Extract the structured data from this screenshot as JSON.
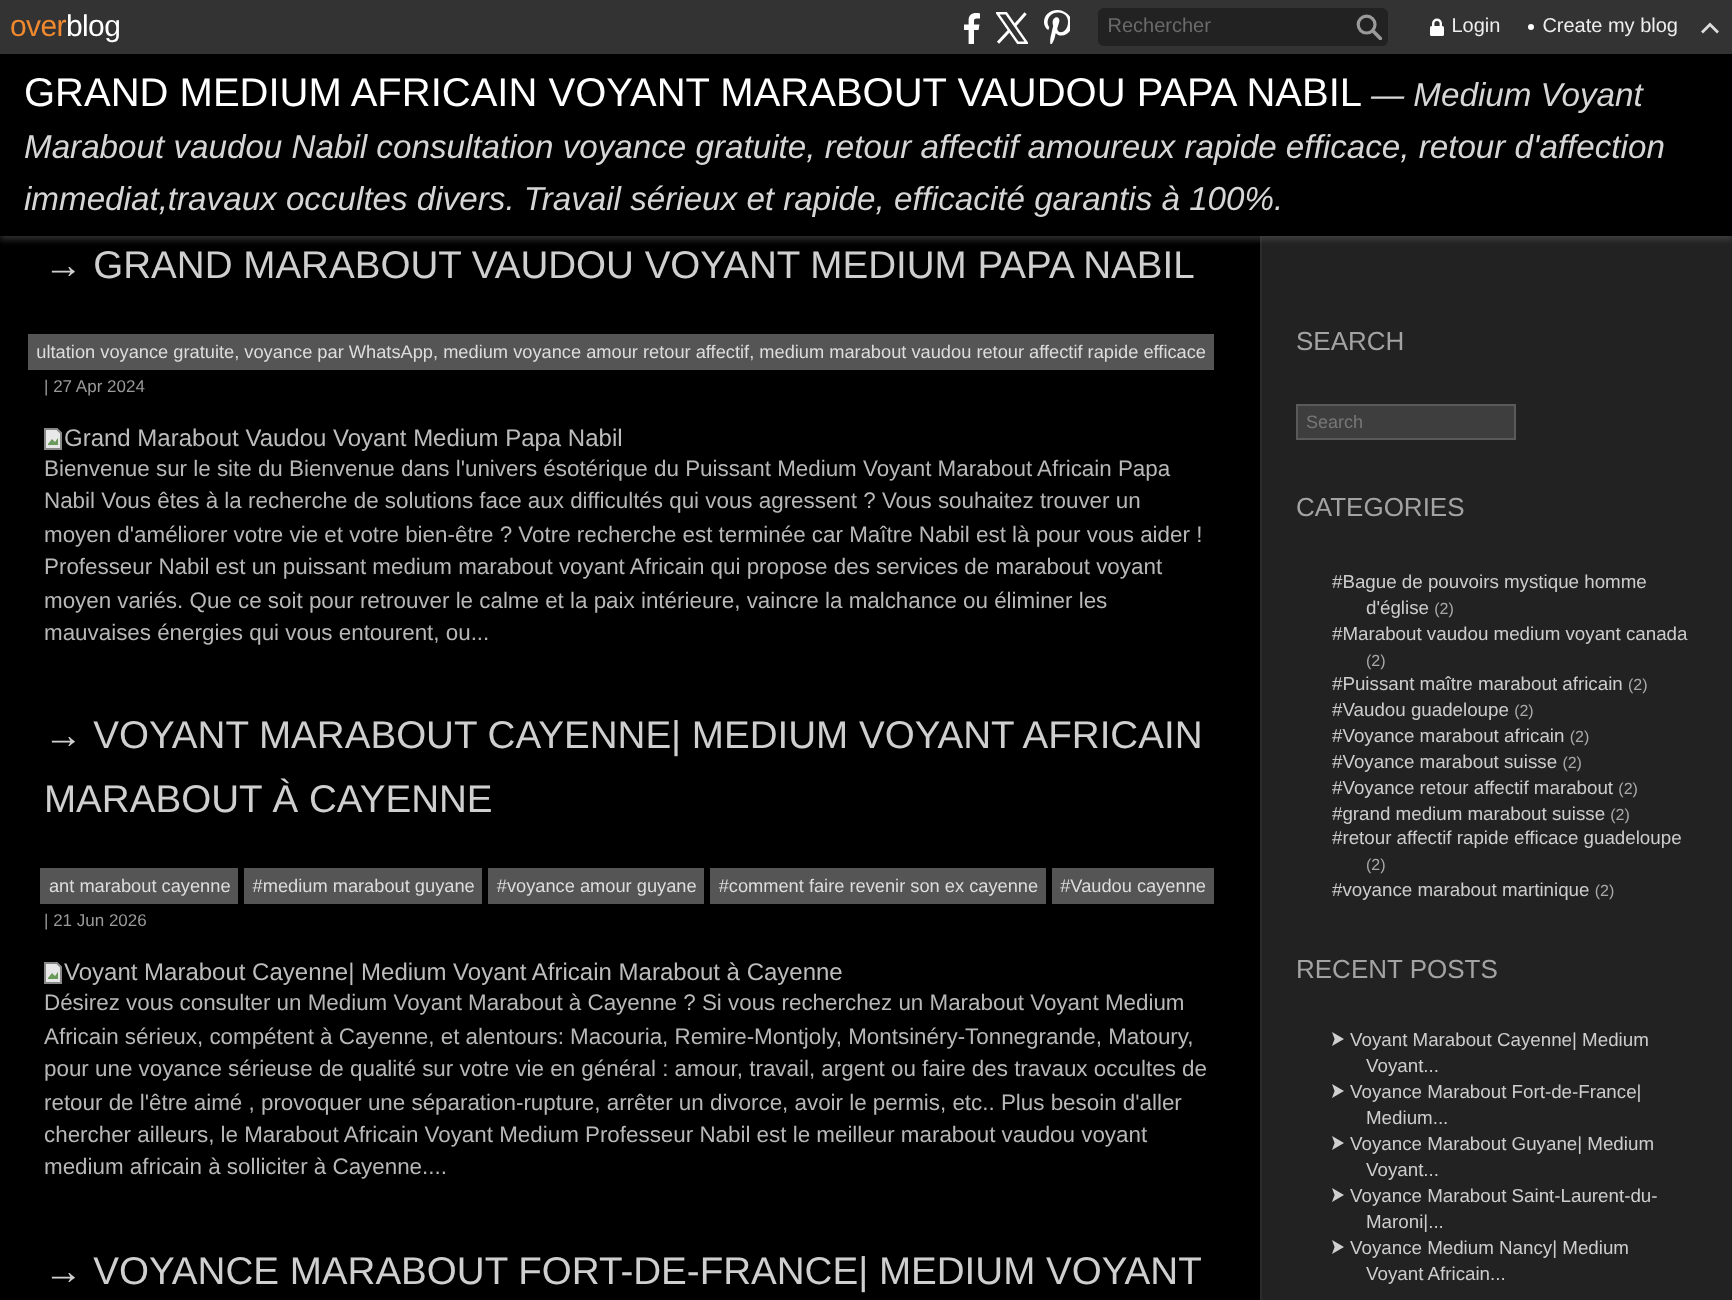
{
  "top_bar": {
    "logo": {
      "accent": "over",
      "rest": "blog"
    },
    "search": {
      "placeholder": "Rechercher"
    },
    "login": "Login",
    "create_blog": "Create my blog"
  },
  "header": {
    "title": "GRAND MEDIUM AFRICAIN VOYANT MARABOUT VAUDOU PAPA NABIL",
    "description": "— Medium Voyant Marabout vaudou Nabil consultation voyance gratuite, retour affectif amoureux rapide efficace, retour d'affection immediat,travaux occultes divers. Travail sérieux et rapide, efficacité garantis à 100%."
  },
  "posts": [
    {
      "title": "→ GRAND MARABOUT VAUDOU VOYANT MEDIUM PAPA NABIL",
      "tags": [
        "ultation voyance gratuite, voyance par WhatsApp, medium voyance amour retour affectif, medium marabout vaudou retour affectif rapide efficace"
      ],
      "date": "| 27 Apr 2024",
      "image_alt": "Grand Marabout Vaudou Voyant Medium Papa Nabil",
      "excerpt": "Bienvenue sur le site du Bienvenue dans l'univers ésotérique du Puissant Medium Voyant Marabout Africain Papa Nabil Vous êtes à la recherche de solutions face aux difficultés qui vous agressent ? Vous souhaitez trouver un moyen d'améliorer votre vie et votre bien-être ? Votre recherche est terminée car Maître Nabil est là pour vous aider ! Professeur Nabil est un puissant medium marabout voyant Africain qui propose des services de marabout voyant moyen variés. Que ce soit pour retrouver le calme et la paix intérieure, vaincre la malchance ou éliminer les mauvaises énergies qui vous entourent, ou..."
    },
    {
      "title": "→ VOYANT MARABOUT CAYENNE| MEDIUM VOYANT AFRICAIN MARABOUT À CAYENNE",
      "tags": [
        "ant marabout cayenne",
        "#medium marabout guyane",
        "#voyance amour guyane",
        "#comment faire revenir son ex cayenne",
        "#Vaudou cayenne"
      ],
      "date": "| 21 Jun 2026",
      "image_alt": "Voyant Marabout Cayenne| Medium Voyant Africain Marabout à Cayenne",
      "excerpt": "Désirez vous consulter un Medium Voyant Marabout à Cayenne ? Si vous recherchez un Marabout Voyant Medium Africain sérieux, compétent à Cayenne, et alentours: Macouria, Remire-Montjoly, Montsinéry-Tonnegrande, Matoury, pour une voyance sérieuse de qualité sur votre vie en général : amour, travail, argent ou faire des travaux occultes de retour de l'être aimé , provoquer une séparation-rupture, arrêter un divorce, avoir le permis, etc.. Plus besoin d'aller chercher ailleurs, le Marabout Africain Voyant Medium Professeur Nabil est le meilleur marabout vaudou voyant medium africain à solliciter à Cayenne...."
    },
    {
      "title": "→ VOYANCE MARABOUT FORT-DE-FRANCE| MEDIUM VOYANT"
    }
  ],
  "sidebar": {
    "search": {
      "heading": "SEARCH",
      "placeholder": "Search"
    },
    "categories": {
      "heading": "CATEGORIES",
      "items": [
        {
          "label": "#Bague de pouvoirs mystique homme d'église",
          "count": "(2)"
        },
        {
          "label": "#Marabout vaudou medium voyant canada",
          "count": "(2)"
        },
        {
          "label": "#Puissant maître marabout africain",
          "count": "(2)"
        },
        {
          "label": "#Vaudou guadeloupe",
          "count": "(2)"
        },
        {
          "label": "#Voyance marabout africain",
          "count": "(2)"
        },
        {
          "label": "#Voyance marabout suisse",
          "count": "(2)"
        },
        {
          "label": "#Voyance retour affectif marabout",
          "count": "(2)"
        },
        {
          "label": "#grand medium marabout suisse",
          "count": "(2)"
        },
        {
          "label": "#retour affectif rapide efficace guadeloupe",
          "count": "(2)"
        },
        {
          "label": "#voyance marabout martinique",
          "count": "(2)"
        }
      ]
    },
    "recent_posts": {
      "heading": "RECENT POSTS",
      "items": [
        "Voyant Marabout Cayenne| Medium Voyant...",
        "Voyance Marabout Fort-de-France| Medium...",
        "Voyance Marabout Guyane| Medium Voyant...",
        "Voyance Marabout Saint-Laurent-du-Maroni|...",
        "Voyance Medium Nancy| Medium Voyant Africain..."
      ]
    }
  }
}
